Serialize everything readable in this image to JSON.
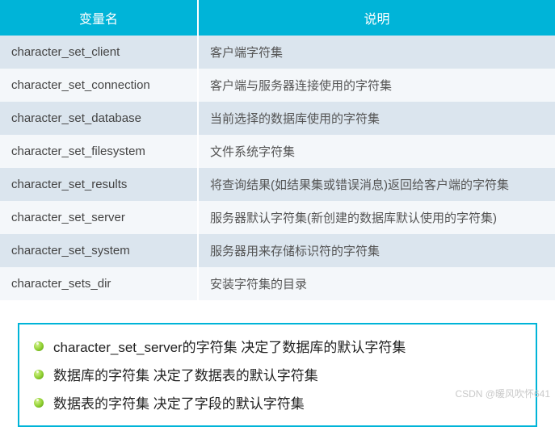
{
  "table": {
    "headers": [
      "变量名",
      "说明"
    ],
    "rows": [
      {
        "name": "character_set_client",
        "desc": "客户端字符集"
      },
      {
        "name": "character_set_connection",
        "desc": "客户端与服务器连接使用的字符集"
      },
      {
        "name": "character_set_database",
        "desc": "当前选择的数据库使用的字符集"
      },
      {
        "name": "character_set_filesystem",
        "desc": "文件系统字符集"
      },
      {
        "name": "character_set_results",
        "desc": "将查询结果(如结果集或错误消息)返回给客户端的字符集"
      },
      {
        "name": "character_set_server",
        "desc": "服务器默认字符集(新创建的数据库默认使用的字符集)"
      },
      {
        "name": "character_set_system",
        "desc": "服务器用来存储标识符的字符集"
      },
      {
        "name": "character_sets_dir",
        "desc": "安装字符集的目录"
      }
    ]
  },
  "notes": [
    "character_set_server的字符集  决定了数据库的默认字符集",
    "数据库的字符集  决定了数据表的默认字符集",
    "数据表的字符集  决定了字段的默认字符集"
  ],
  "watermark": "CSDN @暖风吹怀641"
}
